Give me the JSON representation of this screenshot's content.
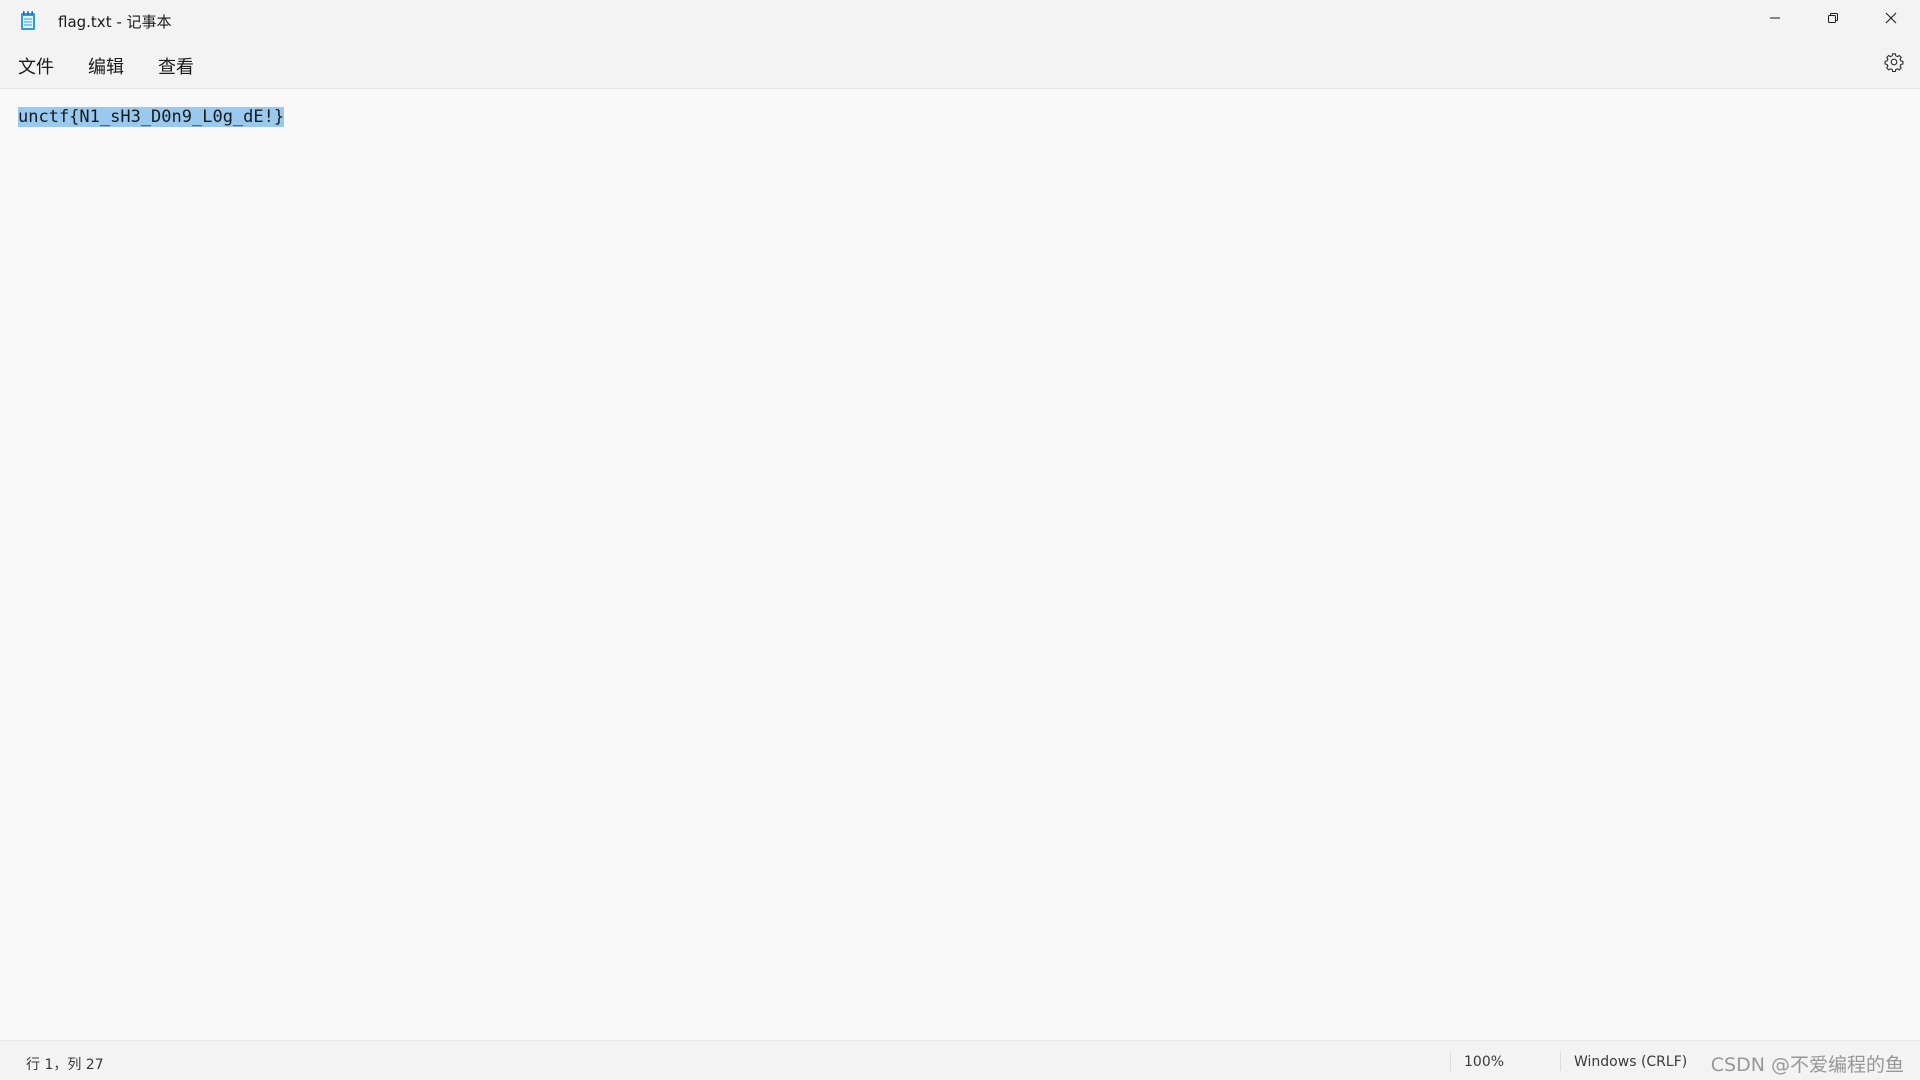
{
  "window": {
    "title": "flag.txt - 记事本",
    "icon": "notepad-icon",
    "controls": {
      "minimize_icon": "minimize-icon",
      "restore_icon": "restore-icon",
      "close_icon": "close-icon"
    }
  },
  "menubar": {
    "items": [
      "文件",
      "编辑",
      "查看"
    ],
    "settings_icon": "gear-icon"
  },
  "editor": {
    "lines": [
      "unctf{N1_sH3_D0n9_L0g_dE!}"
    ],
    "selection_color": "#99c9ef"
  },
  "statusbar": {
    "position": "行 1，列 27",
    "zoom": "100%",
    "line_ending": "Windows (CRLF)",
    "watermark": "CSDN @不爱编程的鱼"
  },
  "colors": {
    "chrome_background": "#f3f3f3",
    "editor_background": "#f9f9f9",
    "icon_accent": "#1e88c8"
  }
}
